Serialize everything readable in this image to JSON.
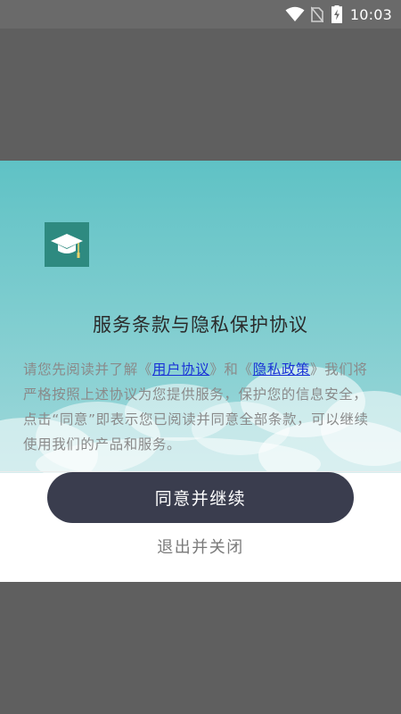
{
  "status_bar": {
    "time": "10:03",
    "icons": [
      "wifi-icon",
      "no-sim-icon",
      "battery-charging-icon"
    ]
  },
  "dialog": {
    "logo_icon": "graduation-cap-icon",
    "title": "服务条款与隐私保护协议",
    "body": {
      "part1": "请您先阅读并了解《",
      "link_user_agreement": "用户协议",
      "part2": "》和《",
      "link_privacy_policy": "隐私政策",
      "part3": "》我们将严格按照上述协议为您提供服务，保护您的信息安全，点击“同意”即表示您已阅读并同意全部条款，可以继续使用我们的产品和服务。"
    },
    "agree_button_label": "同意并继续",
    "exit_button_label": "退出并关闭"
  },
  "colors": {
    "overlay": "#5f5f5f",
    "header_gradient_top": "#5fc2c5",
    "header_gradient_bottom": "#9fd8da",
    "logo_bg": "#2e8a80",
    "link": "#1a33d6",
    "button_bg": "#3a3d4e"
  }
}
